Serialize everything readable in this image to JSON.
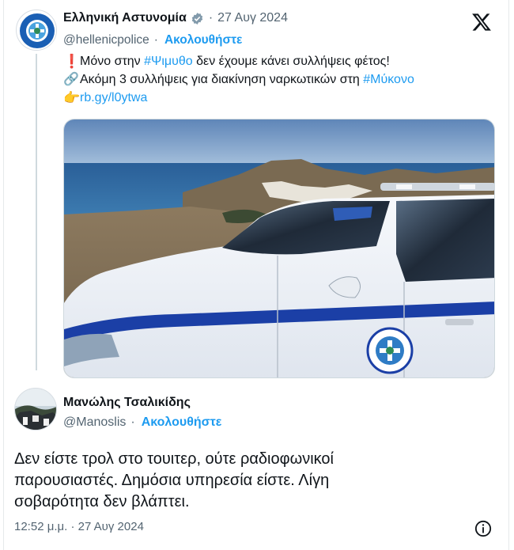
{
  "quoted_tweet": {
    "author_name": "Ελληνική Αστυνομία",
    "verified_icon": "verified-badge-icon",
    "separator": "·",
    "date": "27 Αυγ 2024",
    "handle": "@hellenicpolice",
    "handle_separator": "·",
    "follow_label": "Ακολουθήστε",
    "platform_icon": "x-logo-icon",
    "line1_prefix": "Μόνο στην ",
    "line1_hashtag": "#Ψιμυθο",
    "line1_suffix": " δεν έχουμε κάνει συλλήψεις φέτος!",
    "line2_prefix": "Ακόμη 3 συλλήψεις για διακίνηση ναρκωτικών στη ",
    "line2_hashtag": "#Μύκονο",
    "line3_link": "rb.gy/l0ytwa",
    "photo_seal_text": "ΕΛΛΗΝΙΚΗ ΑΣΤΥΝΟΜΙΑ"
  },
  "reply_tweet": {
    "author_name": "Μανώλης Τσαλικίδης",
    "handle": "@Manoslis",
    "handle_separator": "·",
    "follow_label": "Ακολουθήστε",
    "text_lines": [
      "Δεν είστε τρολ στο τουιτερ, ούτε ραδιοφωνικοί",
      "παρουσιαστές. Δημόσια υπηρεσία είστε. Λίγη",
      "σοβαρότητα δεν βλάπτει."
    ],
    "timestamp": "12:52 μ.μ. · 27 Αυγ 2024",
    "info_icon": "info-icon"
  },
  "colors": {
    "link_blue": "#1d9bf0",
    "text": "#0f1419",
    "muted": "#536471"
  }
}
